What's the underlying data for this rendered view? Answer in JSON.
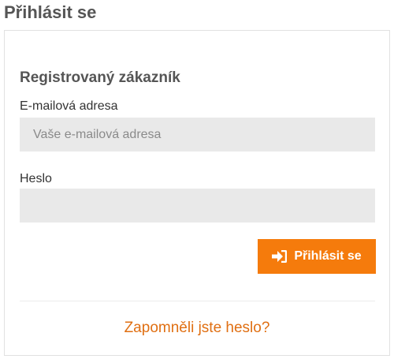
{
  "page": {
    "title": "Přihlásit se"
  },
  "login_form": {
    "heading": "Registrovaný zákazník",
    "email": {
      "label": "E-mailová adresa",
      "placeholder": "Vaše e-mailová adresa",
      "value": ""
    },
    "password": {
      "label": "Heslo",
      "placeholder": "",
      "value": ""
    },
    "submit": {
      "label": "Přihlásit se",
      "icon": "sign-in-icon"
    },
    "forgot_password_link": "Zapomněli jste heslo?"
  },
  "colors": {
    "accent": "#f57b0c",
    "link": "#e06f12",
    "field_background": "#e9e9e9",
    "heading_text": "#555555"
  }
}
